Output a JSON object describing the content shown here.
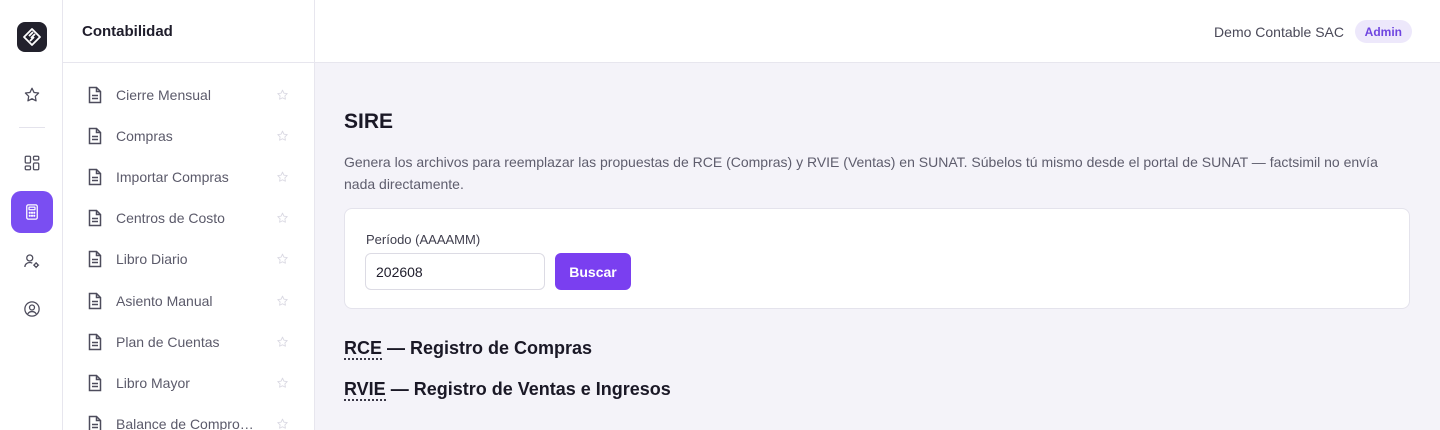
{
  "rail": {
    "logo_icon": "app-logo-icon",
    "items": [
      {
        "icon": "star-icon",
        "active": false
      },
      {
        "icon": "dashboard-grid-icon",
        "active": false
      },
      {
        "icon": "calculator-icon",
        "active": true
      },
      {
        "icon": "user-settings-icon",
        "active": false
      },
      {
        "icon": "user-circle-icon",
        "active": false
      }
    ],
    "accent": "#7a4ef2"
  },
  "sidebar": {
    "title": "Contabilidad",
    "items": [
      {
        "label": "Cierre Mensual"
      },
      {
        "label": "Compras"
      },
      {
        "label": "Importar Compras"
      },
      {
        "label": "Centros de Costo"
      },
      {
        "label": "Libro Diario"
      },
      {
        "label": "Asiento Manual"
      },
      {
        "label": "Plan de Cuentas"
      },
      {
        "label": "Libro Mayor"
      },
      {
        "label": "Balance de Comprobación"
      }
    ]
  },
  "topbar": {
    "company": "Demo Contable SAC",
    "role_badge": "Admin"
  },
  "main": {
    "title": "SIRE",
    "description": "Genera los archivos para reemplazar las propuestas de RCE (Compras) y RVIE (Ventas) en SUNAT. Súbelos tú mismo desde el portal de SUNAT — factsimil no envía nada directamente.",
    "period_label": "Período (AAAAMM)",
    "period_value": "202608",
    "search_button": "Buscar",
    "sections": [
      {
        "abbr": "RCE",
        "title": " — Registro de Compras"
      },
      {
        "abbr": "RVIE",
        "title": " — Registro de Ventas e Ingresos"
      }
    ]
  },
  "colors": {
    "brand": "#7a3ff0",
    "badge_bg": "#ede8fb",
    "badge_text": "#6f45e0"
  }
}
